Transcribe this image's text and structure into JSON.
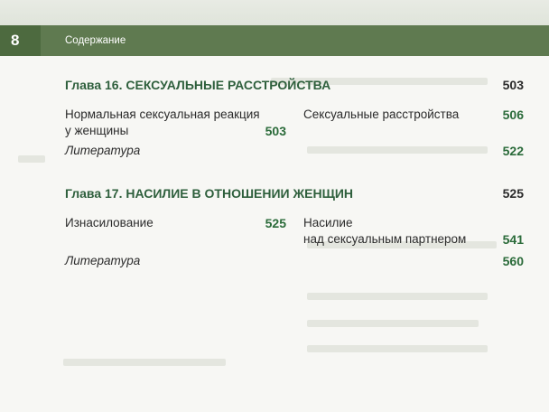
{
  "header": {
    "page_number": "8",
    "section_title": "Содержание"
  },
  "chapters": [
    {
      "title": "Глава 16.  СЕКСУАЛЬНЫЕ РАССТРОЙСТВА",
      "page": "503",
      "entries": [
        {
          "label_line1": "Нормальная сексуальная реакция",
          "label_line2": "у женщины",
          "page": "503"
        },
        {
          "label": "Литература"
        },
        {
          "label": "Сексуальные расстройства",
          "page": "506"
        },
        {
          "page": "522"
        }
      ]
    },
    {
      "title": "Глава 17.  НАСИЛИЕ В ОТНОШЕНИИ ЖЕНЩИН",
      "page": "525",
      "entries": [
        {
          "label": "Изнасилование",
          "page": "525"
        },
        {
          "label": "Литература"
        },
        {
          "label_line1": "Насилие",
          "label_line2": "над сексуальным партнером",
          "page": "541"
        },
        {
          "page": "560"
        }
      ]
    }
  ]
}
